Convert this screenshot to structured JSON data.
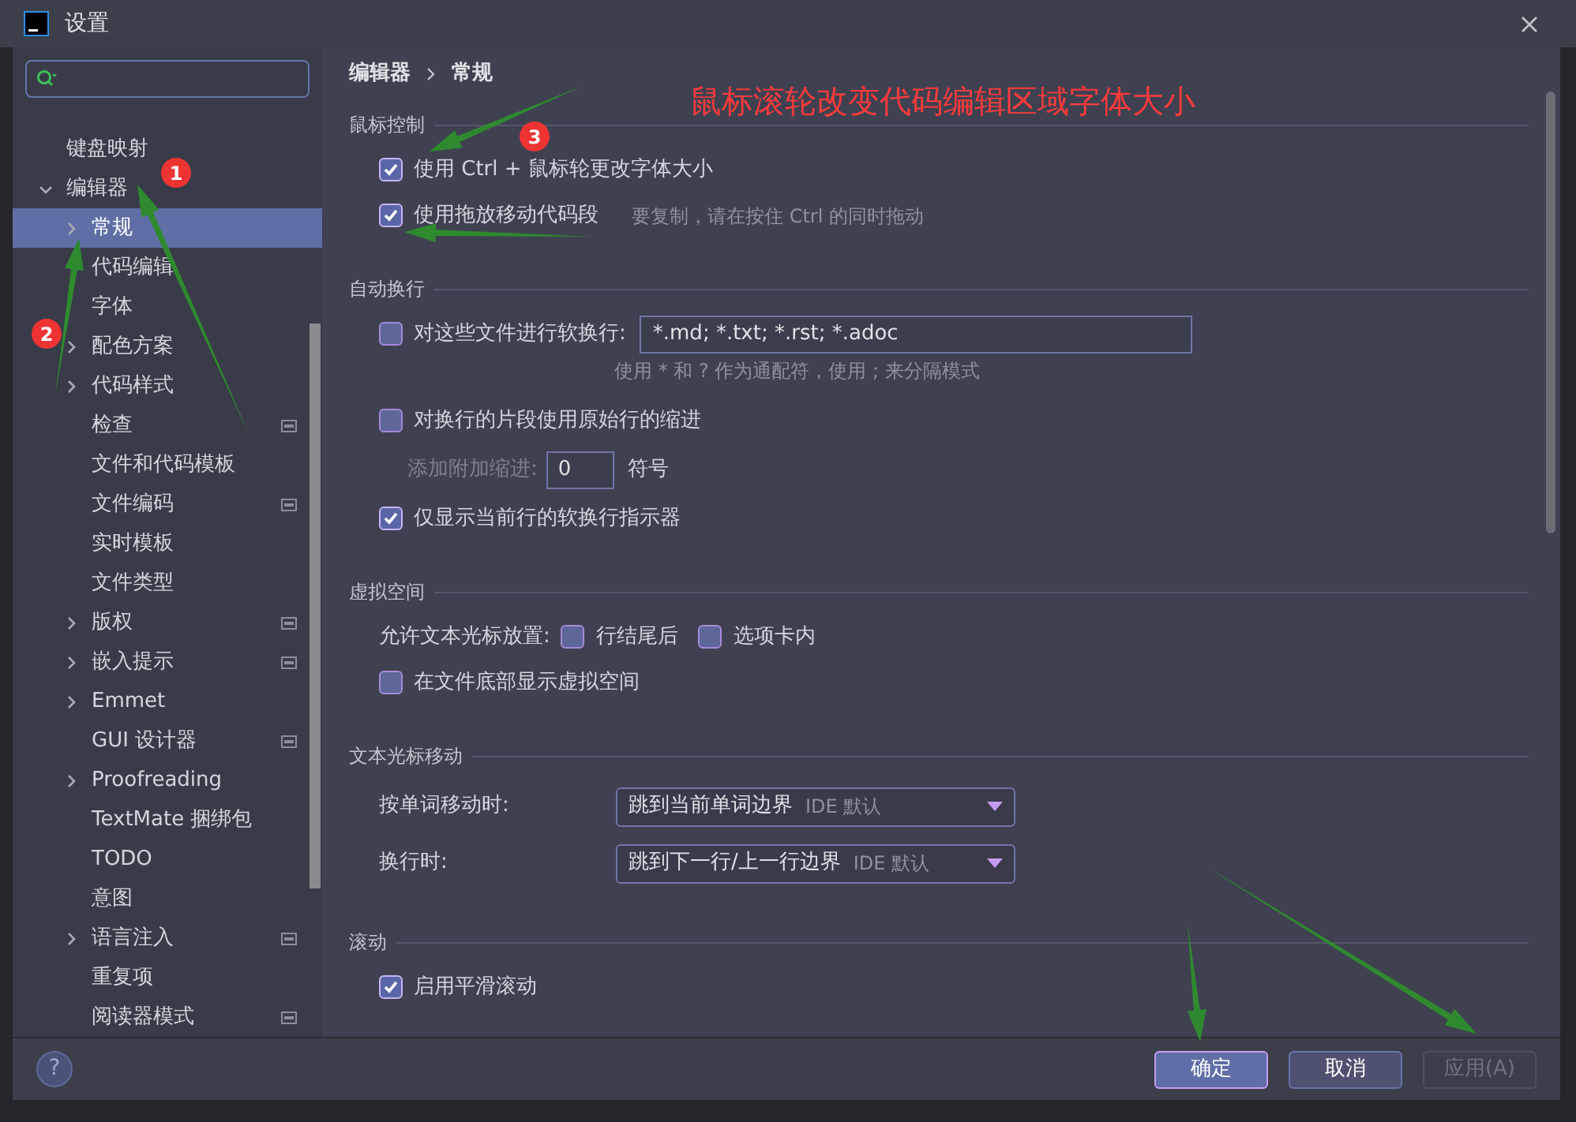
{
  "window": {
    "title": "设置"
  },
  "sidebar": {
    "items": [
      {
        "label": "键盘映射",
        "expandable": false,
        "selected": false,
        "page_icon": false
      },
      {
        "label": "编辑器",
        "expandable": true,
        "expanded": true,
        "selected": false,
        "page_icon": false,
        "children": [
          {
            "label": "常规",
            "expandable": true,
            "expanded": false,
            "selected": true,
            "page_icon": false
          },
          {
            "label": "代码编辑",
            "expandable": false,
            "selected": false,
            "page_icon": false
          },
          {
            "label": "字体",
            "expandable": false,
            "selected": false,
            "page_icon": false
          },
          {
            "label": "配色方案",
            "expandable": true,
            "expanded": false,
            "selected": false,
            "page_icon": false
          },
          {
            "label": "代码样式",
            "expandable": true,
            "expanded": false,
            "selected": false,
            "page_icon": false
          },
          {
            "label": "检查",
            "expandable": false,
            "selected": false,
            "page_icon": true
          },
          {
            "label": "文件和代码模板",
            "expandable": false,
            "selected": false,
            "page_icon": false
          },
          {
            "label": "文件编码",
            "expandable": false,
            "selected": false,
            "page_icon": true
          },
          {
            "label": "实时模板",
            "expandable": false,
            "selected": false,
            "page_icon": false
          },
          {
            "label": "文件类型",
            "expandable": false,
            "selected": false,
            "page_icon": false
          },
          {
            "label": "版权",
            "expandable": true,
            "expanded": false,
            "selected": false,
            "page_icon": true
          },
          {
            "label": "嵌入提示",
            "expandable": true,
            "expanded": false,
            "selected": false,
            "page_icon": true
          },
          {
            "label": "Emmet",
            "expandable": true,
            "expanded": false,
            "selected": false,
            "page_icon": false
          },
          {
            "label": "GUI 设计器",
            "expandable": false,
            "selected": false,
            "page_icon": true
          },
          {
            "label": "Proofreading",
            "expandable": true,
            "expanded": false,
            "selected": false,
            "page_icon": false
          },
          {
            "label": "TextMate 捆绑包",
            "expandable": false,
            "selected": false,
            "page_icon": false
          },
          {
            "label": "TODO",
            "expandable": false,
            "selected": false,
            "page_icon": false
          },
          {
            "label": "意图",
            "expandable": false,
            "selected": false,
            "page_icon": false
          },
          {
            "label": "语言注入",
            "expandable": true,
            "expanded": false,
            "selected": false,
            "page_icon": true
          },
          {
            "label": "重复项",
            "expandable": false,
            "selected": false,
            "page_icon": false
          },
          {
            "label": "阅读器模式",
            "expandable": false,
            "selected": false,
            "page_icon": true
          }
        ]
      }
    ]
  },
  "breadcrumb": [
    "编辑器",
    "常规"
  ],
  "annotation": {
    "title": "鼠标滚轮改变代码编辑区域字体大小",
    "badges": [
      "1",
      "2",
      "3"
    ]
  },
  "sections": [
    {
      "title": "鼠标控制",
      "rows": [
        {
          "kind": "checkbox",
          "label": "使用 Ctrl + 鼠标轮更改字体大小",
          "checked": true
        },
        {
          "kind": "checkbox",
          "label": "使用拖放移动代码段",
          "checked": true,
          "hint": "要复制，请在按住 Ctrl 的同时拖动"
        }
      ]
    },
    {
      "title": "自动换行",
      "rows": [
        {
          "kind": "checkbox_field",
          "label": "对这些文件进行软换行:",
          "checked": false,
          "value": "*.md; *.txt; *.rst; *.adoc"
        },
        {
          "kind": "note",
          "label": "使用 * 和 ? 作为通配符，使用 ; 来分隔模式"
        },
        {
          "kind": "checkbox",
          "label": "对换行的片段使用原始行的缩进",
          "checked": false
        },
        {
          "kind": "number",
          "label": "添加附加缩进:",
          "value": "0",
          "suffix": "符号",
          "disabled": true
        },
        {
          "kind": "checkbox",
          "label": "仅显示当前行的软换行指示器",
          "checked": true
        }
      ]
    },
    {
      "title": "虚拟空间",
      "rows": [
        {
          "kind": "choices",
          "label": "允许文本光标放置:",
          "options": [
            {
              "label": "行结尾后",
              "checked": false
            },
            {
              "label": "选项卡内",
              "checked": false
            }
          ]
        },
        {
          "kind": "checkbox",
          "label": "在文件底部显示虚拟空间",
          "checked": false
        }
      ]
    },
    {
      "title": "文本光标移动",
      "rows": [
        {
          "kind": "dropdown",
          "label": "按单词移动时:",
          "value": "跳到当前单词边界",
          "hint": "IDE 默认"
        },
        {
          "kind": "dropdown",
          "label": "换行时:",
          "value": "跳到下一行/上一行边界",
          "hint": "IDE 默认"
        }
      ]
    },
    {
      "title": "滚动",
      "rows": [
        {
          "kind": "checkbox",
          "label": "启用平滑滚动",
          "checked": true
        }
      ]
    }
  ],
  "buttons": [
    {
      "label": "确定",
      "kind": "primary",
      "disabled": false
    },
    {
      "label": "取消",
      "kind": "default",
      "disabled": false
    },
    {
      "label": "应用(A)",
      "kind": "default",
      "disabled": true
    }
  ],
  "help": {
    "label": "?"
  }
}
